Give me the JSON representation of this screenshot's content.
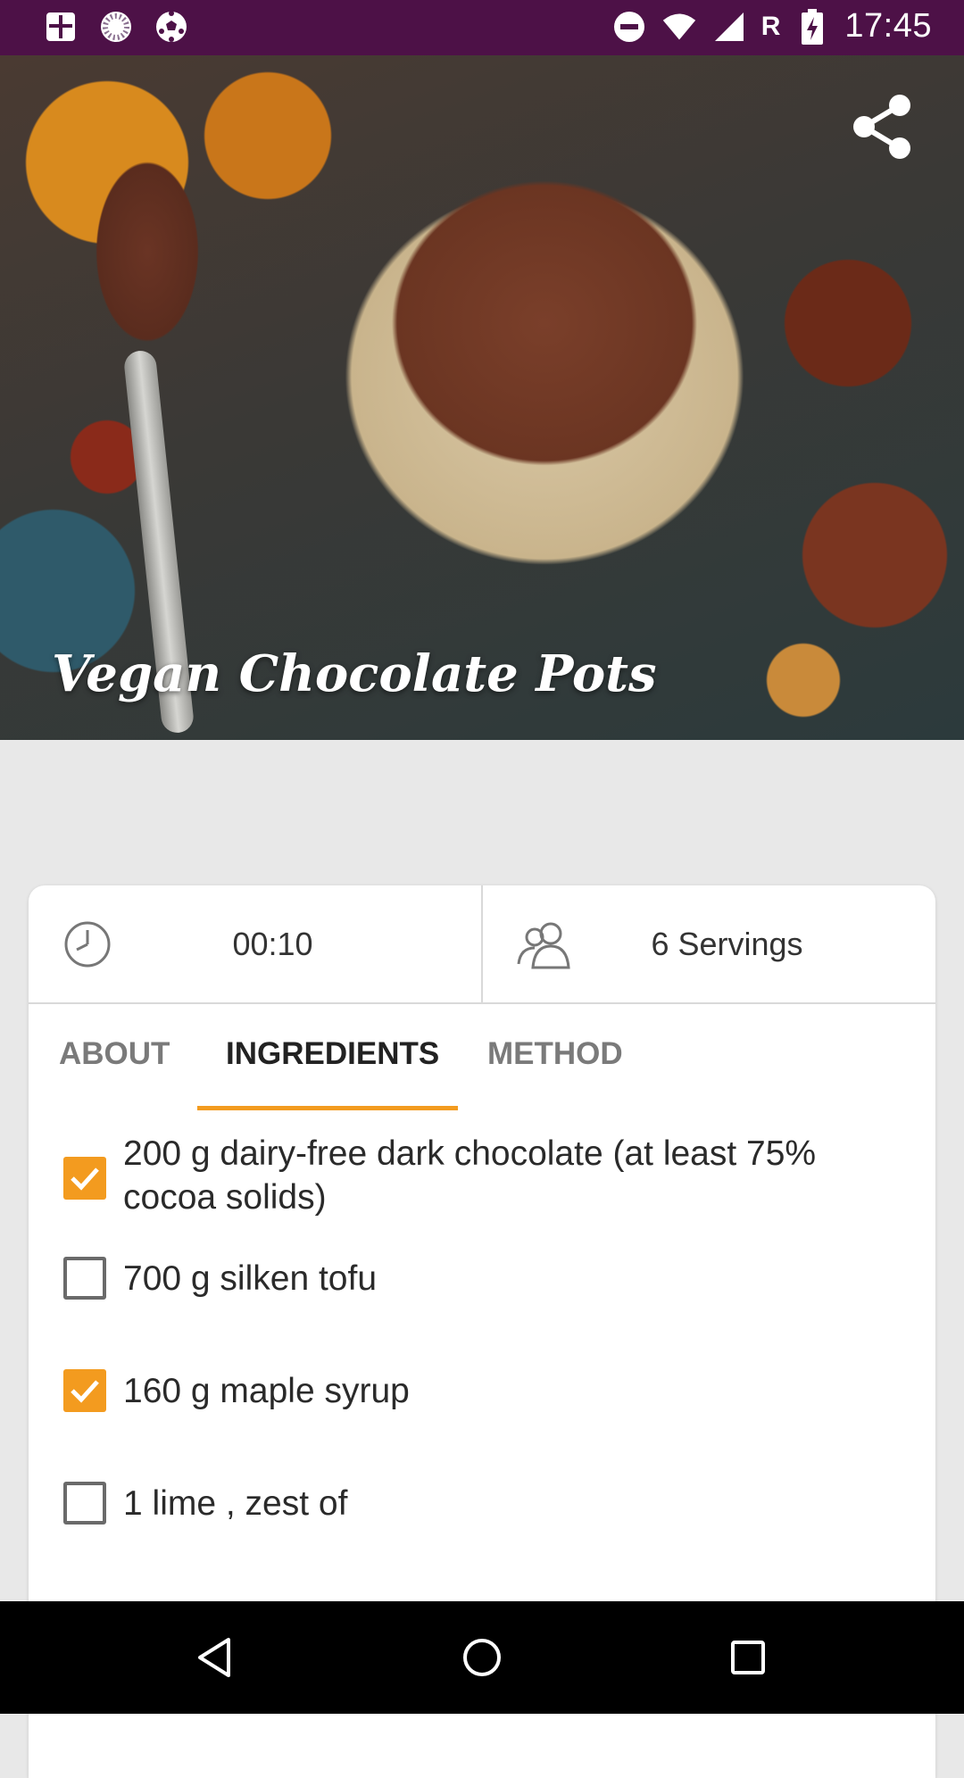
{
  "status_bar": {
    "time": "17:45",
    "roaming": "R",
    "icons": [
      "news-icon",
      "loading-circle-icon",
      "soccer-ball-icon",
      "do-not-disturb-icon",
      "wifi-icon",
      "signal-icon",
      "battery-charging-icon"
    ],
    "color": "#4d1147"
  },
  "recipe": {
    "title": "Vegan Chocolate Pots",
    "time": "00:10",
    "servings": "6 Servings"
  },
  "tabs": [
    {
      "label": "ABOUT",
      "active": false
    },
    {
      "label": "INGREDIENTS",
      "active": true
    },
    {
      "label": "METHOD",
      "active": false
    }
  ],
  "ingredients": [
    {
      "text": "200 g dairy-free dark chocolate (at least 75% cocoa solids)",
      "checked": true
    },
    {
      "text": "700 g silken tofu",
      "checked": false
    },
    {
      "text": "160 g maple syrup",
      "checked": true
    },
    {
      "text": "1 lime , zest of",
      "checked": false
    }
  ],
  "colors": {
    "accent": "#f39b1f",
    "status_bar": "#4d1147",
    "background": "#e8e8e8"
  },
  "nav": {
    "icons": [
      "back-icon",
      "home-icon",
      "recents-icon"
    ]
  }
}
